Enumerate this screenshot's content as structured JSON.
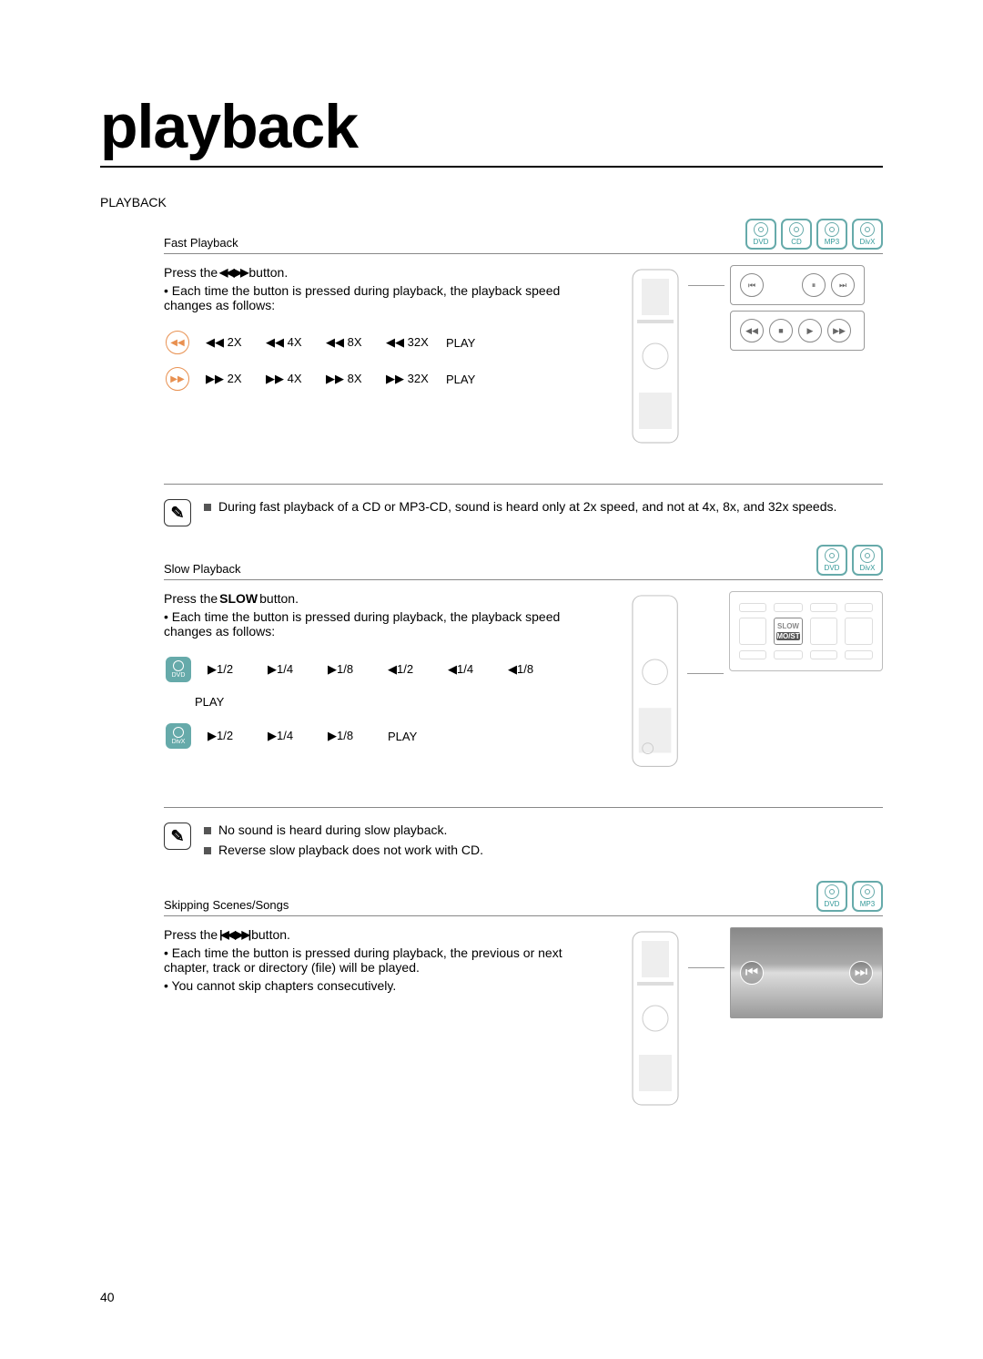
{
  "page_title": "playback",
  "section_header": "PLAYBACK",
  "fast": {
    "title": "Fast Playback",
    "badges": [
      "DVD",
      "CD",
      "MP3",
      "DivX"
    ],
    "press_a": "Press the ",
    "press_b": " button.",
    "glyph": "◀◀,▶▶",
    "bullet": "• Each time the button is pressed during playback, the playback speed changes as follows:",
    "rows": [
      {
        "dir": "◀◀",
        "cells": [
          "◀◀ 2X",
          "◀◀ 4X",
          "◀◀ 8X",
          "◀◀ 32X",
          "PLAY"
        ]
      },
      {
        "dir": "▶▶",
        "cells": [
          "▶▶ 2X",
          "▶▶ 4X",
          "▶▶ 8X",
          "▶▶ 32X",
          "PLAY"
        ]
      }
    ],
    "note": "During fast playback of a CD or MP3-CD, sound is heard only at 2x speed, and not at 4x, 8x, and 32x speeds.",
    "panel_labels": [
      "STOP",
      "PLAY"
    ]
  },
  "slow": {
    "title": "Slow Playback",
    "badges": [
      "DVD",
      "DivX"
    ],
    "press_a": "Press the ",
    "press_b": "SLOW",
    "press_c": " button.",
    "bullet": "• Each time the button is pressed during playback, the playback speed changes as follows:",
    "dvd_row": {
      "badge": "DVD",
      "cells": [
        "▶1/2",
        "▶1/4",
        "▶1/8",
        "◀1/2",
        "◀1/4",
        "◀1/8"
      ],
      "tail": "PLAY"
    },
    "divx_row": {
      "badge": "DivX",
      "cells": [
        "▶1/2",
        "▶1/4",
        "▶1/8",
        "PLAY"
      ]
    },
    "notes": [
      "No sound is heard during slow playback.",
      "Reverse slow playback does not work with CD."
    ],
    "panel": {
      "highlight": "SLOW",
      "sub": "MO/ST"
    }
  },
  "skip": {
    "title": "Skipping Scenes/Songs",
    "badges": [
      "DVD",
      "MP3"
    ],
    "press_a": "Press the ",
    "press_b": " button.",
    "glyph": "|◀◀,▶▶|",
    "bullet1": "• Each time the button is pressed during playback, the previous or next chapter, track or directory (file) will be played.",
    "bullet2": "• You cannot skip chapters consecutively."
  },
  "page_number": "40"
}
